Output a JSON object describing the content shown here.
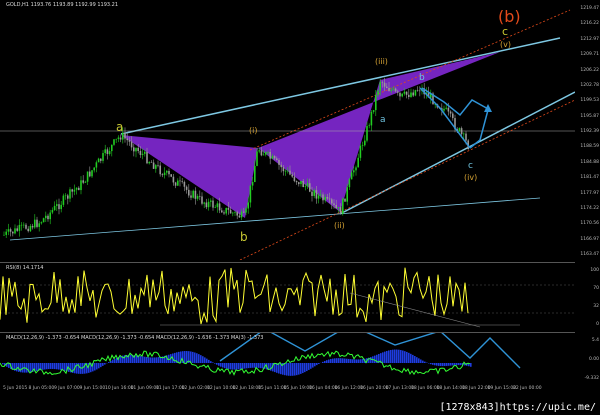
{
  "price_panel": {
    "header": "GOLD,H1  1193.76 1193.89 1192.99 1193.21",
    "axis_ticks": [
      "1219.47",
      "1216.22",
      "1212.97",
      "1209.71",
      "1206.22",
      "1202.78",
      "1199.53",
      "1195.87",
      "1192.39",
      "1188.59",
      "1184.88",
      "1181.47",
      "1177.97",
      "1174.22",
      "1170.56",
      "1166.97",
      "1163.47"
    ],
    "wave_labels": {
      "a": "a",
      "b": "b",
      "i": "(i)",
      "ii": "(ii)",
      "iii": "(iii)",
      "iv": "(iv)",
      "v": "(v)",
      "minor_b": "b",
      "minor_a": "a",
      "minor_c": "c",
      "big_b": "(b)",
      "big_c": "c"
    }
  },
  "rsi_panel": {
    "header": "RSI(8) 14.1714",
    "axis_ticks": [
      "100",
      "70",
      "32",
      "0"
    ]
  },
  "macd_panel": {
    "header": "MACD(12,26,9) -1.373 -0.654  MACD(12,26,9) -1.373 -0.654  MACD(12,26,9) -1.636 -1.373  MA(3) -1.373",
    "axis_ticks": [
      "5.4",
      "0.00",
      "-9.332"
    ]
  },
  "time_axis": [
    "5 Jun 2015",
    "8 Jun 05:00",
    "9 Jun 07:00",
    "9 Jun 15:00",
    "10 Jun 16:00",
    "11 Jun 09:00",
    "11 Jun 17:00",
    "12 Jun 02:00",
    "12 Jun 10:00",
    "12 Jun 18:00",
    "15 Jun 11:00",
    "15 Jun 19:00",
    "16 Jun 04:00",
    "16 Jun 12:00",
    "16 Jun 20:00",
    "17 Jun 13:00",
    "18 Jun 06:00",
    "18 Jun 14:00",
    "18 Jun 22:00",
    "19 Jun 15:00",
    "22 Jun 00:00"
  ],
  "watermark": "[1278x843]https://upic.me/",
  "colors": {
    "bull": "#22cc22",
    "bear": "#999999",
    "pattern": "#8a2be2",
    "trend": "#7ec8e3",
    "wave_yellow": "#c8c832",
    "wave_red": "#e24a1a",
    "arrow": "#2f93d6",
    "rsi": "#ffff33",
    "macd_hist": "#1e3ce0",
    "macd_line": "#33ff33"
  }
}
